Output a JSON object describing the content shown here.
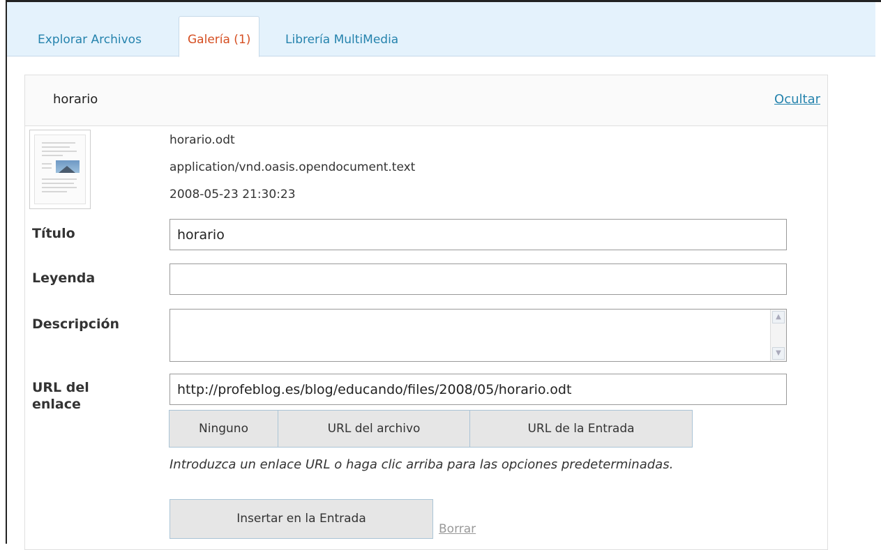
{
  "tabs": [
    {
      "label": "Explorar Archivos"
    },
    {
      "label": "Galería (1)"
    },
    {
      "label": "Librería MultiMedia"
    }
  ],
  "item": {
    "title": "horario",
    "hide_label": "Ocultar",
    "filename": "horario.odt",
    "mime": "application/vnd.oasis.opendocument.text",
    "date": "2008-05-23 21:30:23"
  },
  "form": {
    "title_label": "Título",
    "title_value": "horario",
    "caption_label": "Leyenda",
    "caption_value": "",
    "description_label": "Descripción",
    "url_label_line1": "URL del",
    "url_label_line2": "enlace",
    "url_value": "http://profeblog.es/blog/educando/files/2008/05/horario.odt",
    "url_buttons": {
      "none": "Ninguno",
      "file": "URL del archivo",
      "post": "URL de la Entrada"
    },
    "hint": "Introduzca un enlace URL o haga clic arriba para las opciones predeterminadas.",
    "insert_label": "Insertar en la Entrada",
    "delete_label": "Borrar"
  }
}
